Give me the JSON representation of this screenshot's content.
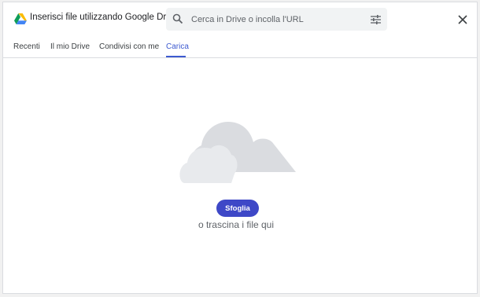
{
  "dialog": {
    "title": "Inserisci file utilizzando Google Drive",
    "logo_icon": "google-drive-icon",
    "close_icon": "close-icon"
  },
  "search": {
    "placeholder": "Cerca in Drive o incolla l'URL",
    "value": "",
    "search_icon": "search-icon",
    "options_icon": "tune-icon"
  },
  "tabs": [
    {
      "label": "Recenti",
      "active": false
    },
    {
      "label": "Il mio Drive",
      "active": false
    },
    {
      "label": "Condivisi con me",
      "active": false
    },
    {
      "label": "Carica",
      "active": true
    }
  ],
  "upload": {
    "illustration": "cloud-illustration",
    "browse_label": "Sfoglia",
    "drop_text": "o trascina i file qui"
  },
  "colors": {
    "accent": "#3d5ad0",
    "button": "#3e48c7",
    "cloud_back": "#dadce0",
    "cloud_front": "#e8eaed"
  }
}
